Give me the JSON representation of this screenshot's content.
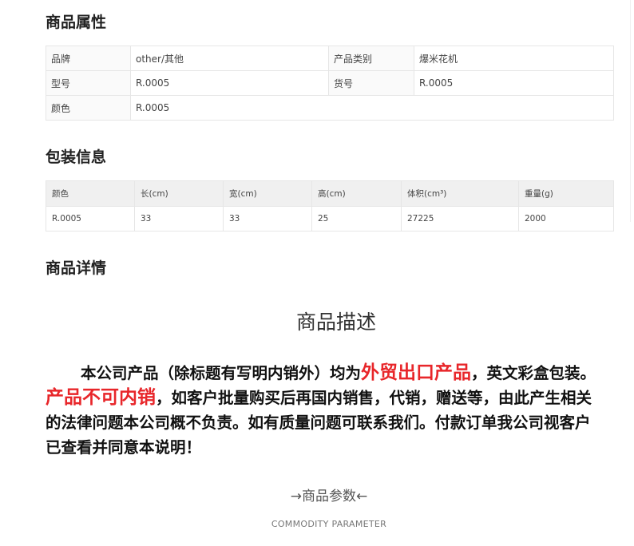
{
  "attributes": {
    "title": "商品属性",
    "rows": [
      [
        "品牌",
        "other/其他",
        "产品类别",
        "爆米花机"
      ],
      [
        "型号",
        "R.0005",
        "货号",
        "R.0005"
      ],
      [
        "颜色",
        "R.0005"
      ]
    ]
  },
  "packaging": {
    "title": "包装信息",
    "headers": [
      "颜色",
      "长(cm)",
      "宽(cm)",
      "高(cm)",
      "体积(cm³)",
      "重量(g)"
    ],
    "row": [
      "R.0005",
      "33",
      "33",
      "25",
      "27225",
      "2000"
    ]
  },
  "details": {
    "title": "商品详情",
    "desc_title": "商品描述",
    "desc_part1": "本公司产品（除标题有写明内销外）均为",
    "desc_red1": "外贸出口产品",
    "desc_part2": "，英文彩盒包装。",
    "desc_red2": "产品不可内销",
    "desc_part3": "，如客户批量购买后再国内销售，代销，赠送等，由此产生相关的法律问题本公司概不负责。如有质量问题可联系我们。付款订单我公司视客户已查看并同意本说明！",
    "param_title": "→商品参数←",
    "param_sub": "COMMODITY  PARAMETER"
  },
  "colors": {
    "highlight_red": "#e8262a"
  }
}
